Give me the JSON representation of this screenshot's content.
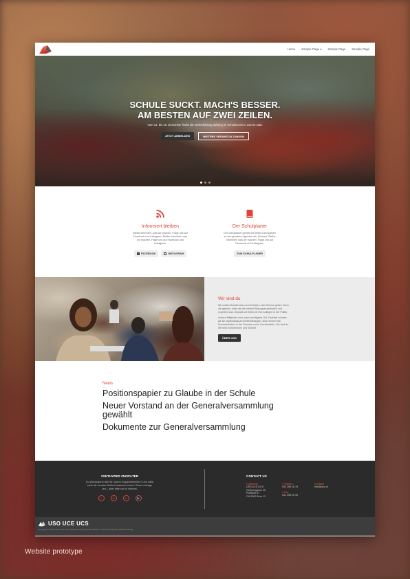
{
  "caption": "Website prototype",
  "nav": {
    "links": [
      "Home",
      "Sample Page ▾",
      "Sample Page",
      "Sample Page"
    ]
  },
  "hero": {
    "title": "SCHULE SUCKT. MACH'S BESSER. AM BESTEN AUF ZWEI ZEILEN.",
    "subtitle": "Vom 14. bis 15. Dezember findet die Weiterbildung Stiftung im Schulwesen in Luzern statt.",
    "btn_primary": "JETZT ANMELDEN",
    "btn_secondary": "WEITERE VERANSTALTUNGEN"
  },
  "features": [
    {
      "icon": "rss-icon",
      "title": "Informiert bleiben",
      "text": "Bleibe informiert, was wir machen. Folge uns auf Facebook und Instagram. Bleibe informiert, was wir machen. Folge uns auf Facebook und Instagram.",
      "buttons": [
        "FACEBOOK",
        "INSTAGRAM"
      ]
    },
    {
      "icon": "book-icon",
      "title": "Der Schulplaner",
      "text": "Der Schulplaner gehört mit 30000 Exemplaren zu den grössten Agenden der Schweiz. Bleibe informiert, was wir machen. Folge uns auf Facebook und Instagram.",
      "buttons": [
        "ZUM SCHULPLANER"
      ]
    }
  ],
  "about": {
    "title": "Wir sind du",
    "p1": "Wir wollen Schülerinnen und Schülern eine Stimme geben. Denn wir glauben, dass sie die wahren Bildungsexpertinnen und -experten sind. Deshalb vertreten wir ihre Anliegen in der Politik.",
    "p2": "Unsere Mitglieder sind unser wichtigstes Gut. Deshalb schulen wir sie regelmässig an Weiterbildungen, sind vernetzt mit Freundschaften in der Schweiz und in Liechtenstein. Wir sind du. Wir sind Schülerinnen und Schüler.",
    "button": "ÜBER UNS"
  },
  "news": {
    "label": "News",
    "items": [
      "Positionspapier zu Glaube in der Schule",
      "Neuer Vorstand an der Generalversammlung gewählt",
      "Dokumente zur Generalversammlung"
    ]
  },
  "footer": {
    "hashtag_title": "#GETHYPED #NOFILTER",
    "hashtag_text": "Du interessierst dich für unsere Exgepeilteheiten? Und willst stets die neusten Selfie-Kreationen sehen? Dann verfolge uns – aber bitte nur im Internet.",
    "social": [
      "f",
      "◎",
      "▪▪",
      "🐦"
    ],
    "contact_title": "CONTACT US",
    "address_label": "Adresse",
    "address": [
      "USO UCE UCS",
      "Gerberngasse 39",
      "Postfach 87",
      "CH-3000 Bern 13"
    ],
    "phone_label": "Telefon",
    "phone": "031 398 18 78",
    "fax_label": "Fax",
    "fax": "031 398 18 16",
    "email_label": "E-Mail",
    "email": "info@uso.ch"
  },
  "bottombar": {
    "logo_text": "USO UCE UCS",
    "copy": "Copyright © 2015 USO UCE UCS. Website powered by WordPress. Theme developed by Robin Staring."
  },
  "colors": {
    "accent": "#e04438",
    "footer_bg": "#2b2b2b",
    "bottombar_bg": "#3d3d3d"
  }
}
